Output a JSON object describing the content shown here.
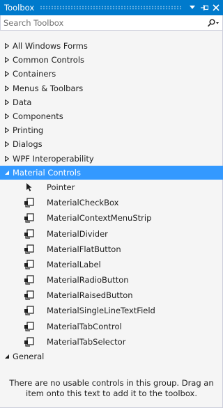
{
  "window": {
    "title": "Toolbox"
  },
  "search": {
    "placeholder": "Search Toolbox"
  },
  "categories_before": [
    {
      "label": "All Windows Forms"
    },
    {
      "label": "Common Controls"
    },
    {
      "label": "Containers"
    },
    {
      "label": "Menus & Toolbars"
    },
    {
      "label": "Data"
    },
    {
      "label": "Components"
    },
    {
      "label": "Printing"
    },
    {
      "label": "Dialogs"
    },
    {
      "label": "WPF Interoperability"
    }
  ],
  "material": {
    "label": "Material Controls",
    "expanded": true,
    "selected": true,
    "items": [
      {
        "label": "Pointer",
        "icon": "pointer-icon"
      },
      {
        "label": "MaterialCheckBox",
        "icon": "component-icon"
      },
      {
        "label": "MaterialContextMenuStrip",
        "icon": "component-icon"
      },
      {
        "label": "MaterialDivider",
        "icon": "component-icon"
      },
      {
        "label": "MaterialFlatButton",
        "icon": "component-icon"
      },
      {
        "label": "MaterialLabel",
        "icon": "component-icon"
      },
      {
        "label": "MaterialRadioButton",
        "icon": "component-icon"
      },
      {
        "label": "MaterialRaisedButton",
        "icon": "component-icon"
      },
      {
        "label": "MaterialSingleLineTextField",
        "icon": "component-icon"
      },
      {
        "label": "MaterialTabControl",
        "icon": "component-icon"
      },
      {
        "label": "MaterialTabSelector",
        "icon": "component-icon"
      }
    ]
  },
  "general": {
    "label": "General",
    "expanded": true,
    "empty_message": "There are no usable controls in this group. Drag an item onto this text to add it to the toolbox."
  },
  "colors": {
    "titlebar": "#007acc",
    "selection": "#3399ff",
    "background": "#f5f5f5"
  }
}
